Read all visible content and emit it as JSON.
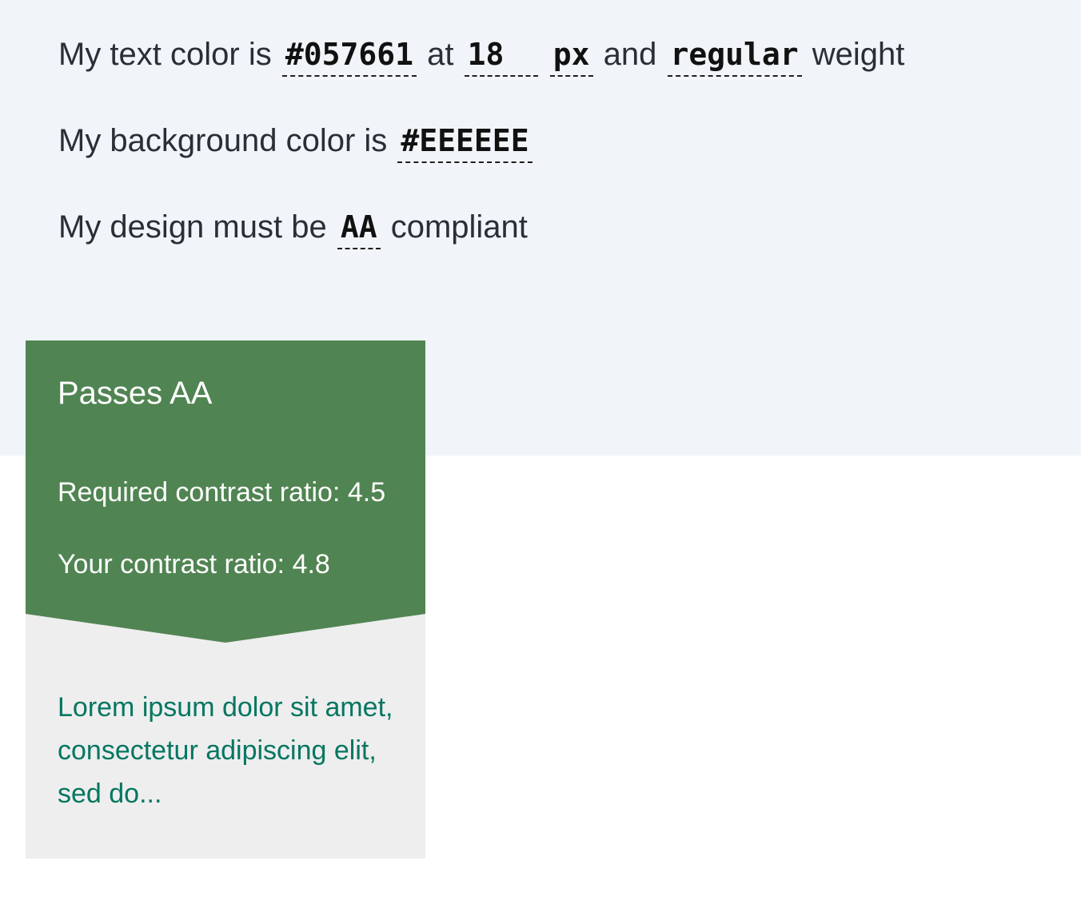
{
  "settings": {
    "line1": {
      "prefix": "My text color is",
      "text_color": "#057661",
      "at": "at",
      "font_size": "18",
      "unit": "px",
      "and": "and",
      "weight": "regular",
      "suffix": "weight"
    },
    "line2": {
      "prefix": "My background color is",
      "background_color": "#EEEEEE"
    },
    "line3": {
      "prefix": "My design must be",
      "level": "AA",
      "suffix": "compliant"
    }
  },
  "result": {
    "title": "Passes AA",
    "required_label": "Required contrast ratio: 4.5",
    "actual_label": "Your contrast ratio: 4.8",
    "banner_color": "#508452",
    "status": "pass"
  },
  "preview": {
    "sample_text": "Lorem ipsum dolor sit amet, consectetur adipiscing elit, sed do...",
    "text_color": "#057661",
    "background_color": "#EEEEEE"
  },
  "colors": {
    "page_top_background": "#F1F4F8",
    "page_bottom_background": "#FFFFFF",
    "body_text": "#2A2F36"
  }
}
